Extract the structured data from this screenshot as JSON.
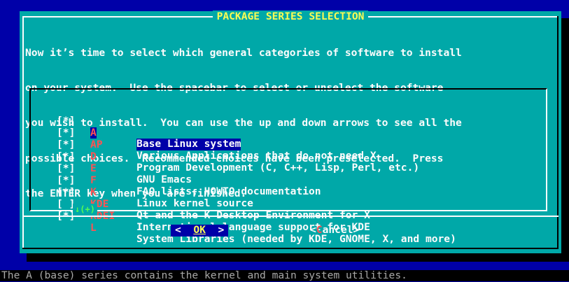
{
  "dialog": {
    "title": "PACKAGE SERIES SELECTION",
    "prompt_lines": [
      "Now it’s time to select which general categories of software to install",
      "on your system.  Use the spacebar to select or unselect the software",
      "you wish to install.  You can use the up and down arrows to see all the",
      "possible choices.  Recommended choices have been preselected.  Press",
      "the ENTER key when you are finished."
    ],
    "items": [
      {
        "check": "[*]",
        "tag": "A",
        "desc": "Base Linux system",
        "highlighted": true
      },
      {
        "check": "[*]",
        "tag": "AP",
        "desc": "Various Applications that do not need X"
      },
      {
        "check": "[*]",
        "tag": "D",
        "desc": "Program Development (C, C++, Lisp, Perl, etc.)"
      },
      {
        "check": "[*]",
        "tag": "E",
        "desc": "GNU Emacs"
      },
      {
        "check": "[*]",
        "tag": "F",
        "desc": "FAQ lists, HOWTO documentation"
      },
      {
        "check": "[*]",
        "tag": "K",
        "desc": "Linux kernel source"
      },
      {
        "check": "[*]",
        "tag": "KDE",
        "desc": "Qt and the K Desktop Environment for X"
      },
      {
        "check": "[ ]",
        "tag": "KDEI",
        "desc": "International language support for KDE"
      },
      {
        "check": "[*]",
        "tag": "L",
        "desc": "System Libraries (needed by KDE, GNOME, X, and more)"
      }
    ],
    "scroll_indicator": "↓(+)",
    "buttons": {
      "ok": {
        "left": "<  ",
        "key": "OK",
        "right": "  >"
      },
      "cancel": {
        "left": "<",
        "key": "C",
        "rest": "ancel>"
      }
    }
  },
  "status_line": "The A (base) series contains the kernel and main system utilities."
}
